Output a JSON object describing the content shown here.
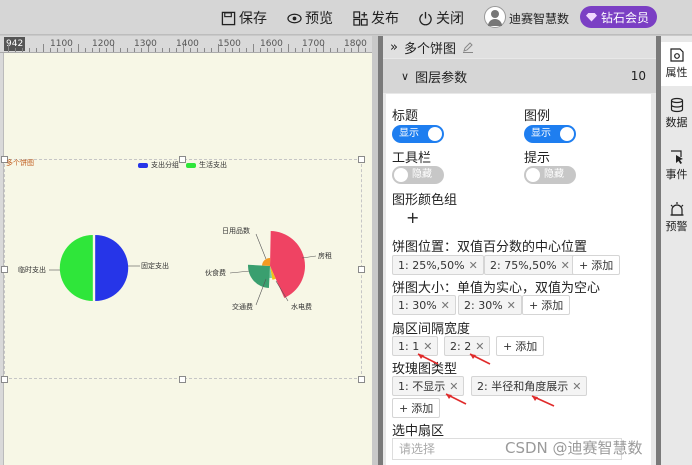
{
  "toolbar": {
    "save_label": "保存",
    "preview_label": "预览",
    "publish_label": "发布",
    "close_label": "关闭",
    "brand": "迪赛智慧数",
    "vip_label": "钻石会员"
  },
  "ruler": {
    "current": "942",
    "marks": [
      "1100",
      "1200",
      "1300",
      "1400",
      "1500",
      "1600",
      "1700",
      "1800"
    ]
  },
  "chart_data": [
    {
      "type": "pie",
      "title": "多个饼图",
      "legend": [
        "支出分组",
        "生活支出"
      ],
      "slices": [
        {
          "label": "固定支出",
          "value": 50,
          "color": "#2635e8"
        },
        {
          "label": "临时支出",
          "value": 50,
          "color": "#2fe63a"
        }
      ]
    },
    {
      "type": "pie",
      "rose": true,
      "slices": [
        {
          "label": "房租",
          "value": 40,
          "color": "#ef4363"
        },
        {
          "label": "水电费",
          "value": 5,
          "color": "#f0c419"
        },
        {
          "label": "交通费",
          "value": 5,
          "color": "#7ad0a8"
        },
        {
          "label": "伙食费",
          "value": 30,
          "color": "#3a9f6f"
        },
        {
          "label": "日用品数",
          "value": 20,
          "color": "#f39a21"
        }
      ]
    }
  ],
  "panel": {
    "header": "多个饼图",
    "section_title": "图层参数",
    "section_count": "10",
    "title_label": "标题",
    "title_toggle": "显示",
    "legend_label": "图例",
    "legend_toggle": "显示",
    "toolbar_label": "工具栏",
    "toolbar_toggle": "隐藏",
    "tip_label": "提示",
    "tip_toggle": "隐藏",
    "color_group_label": "图形颜色组",
    "position_label": "饼图位置：双值百分数的中心位置",
    "position_tags": [
      "1: 25%,50%",
      "2: 75%,50%"
    ],
    "size_label": "饼图大小：单值为实心，双值为空心",
    "size_tags": [
      "1: 30%",
      "2: 30%"
    ],
    "gap_label": "扇区间隔宽度",
    "gap_tags": [
      "1: 1",
      "2: 2"
    ],
    "rose_label": "玫瑰图类型",
    "rose_tags": [
      "1: 不显示",
      "2: 半径和角度展示"
    ],
    "selected_label": "选中扇区",
    "selected_placeholder": "请选择",
    "add_label": "添加"
  },
  "tools": {
    "attrs": "属性",
    "data": "数据",
    "events": "事件",
    "alerts": "预警"
  },
  "watermark": "CSDN @迪赛智慧数"
}
